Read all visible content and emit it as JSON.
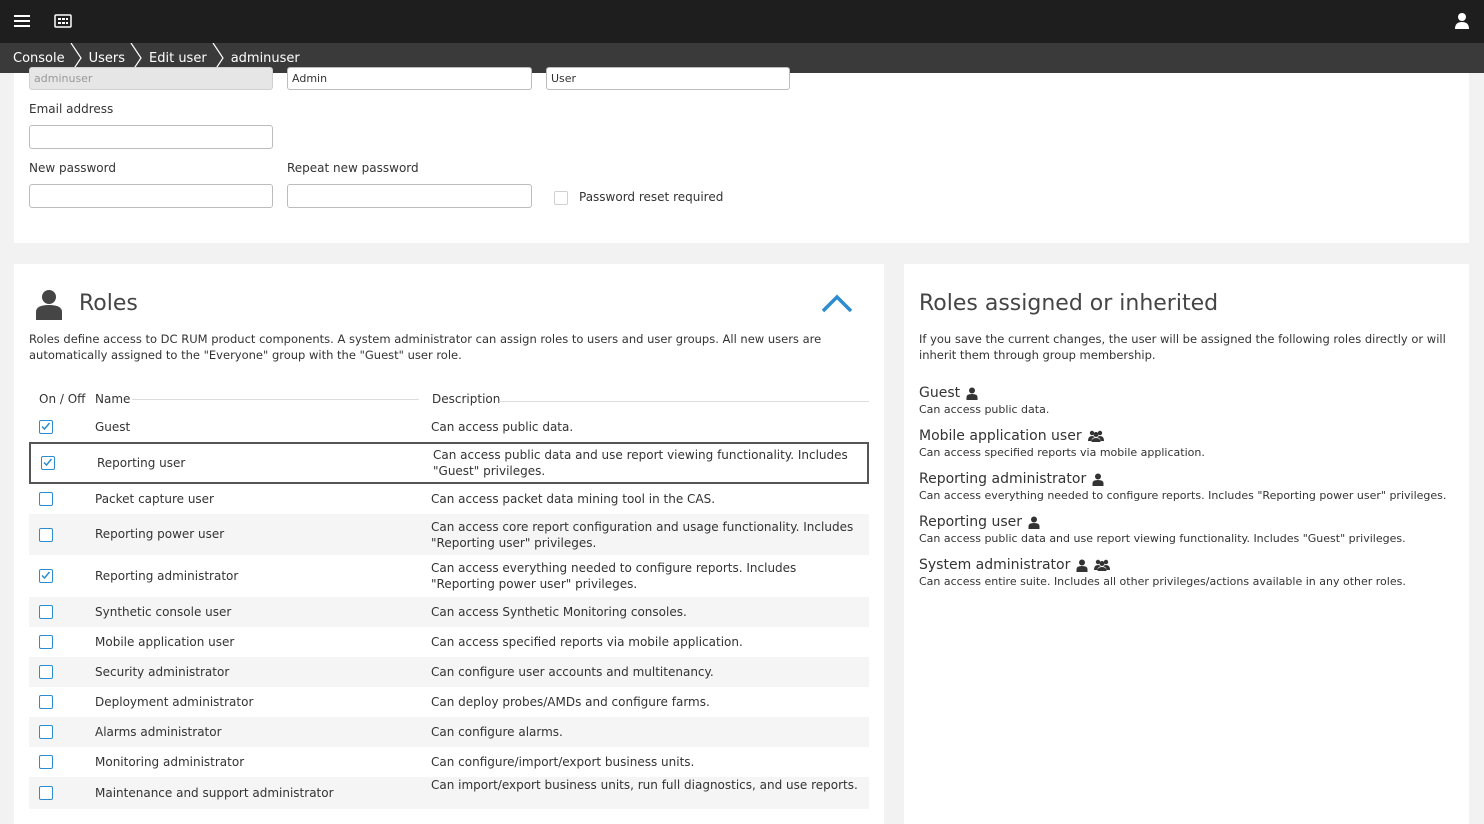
{
  "topbar": {
    "menu_icon": "hamburger-menu-icon",
    "dashboard_icon": "dashboard-icon",
    "user_icon": "user-icon"
  },
  "breadcrumb": [
    "Console",
    "Users",
    "Edit user",
    "adminuser"
  ],
  "user_form": {
    "username_value": "adminuser",
    "first_name_value": "Admin",
    "last_name_value": "User",
    "email_label": "Email address",
    "email_value": "",
    "new_password_label": "New password",
    "repeat_password_label": "Repeat new password",
    "password_reset_label": "Password reset required"
  },
  "roles": {
    "title": "Roles",
    "description": "Roles define access to DC RUM product components. A system administrator can assign roles to users and user groups. All new users are automatically assigned to the \"Everyone\" group with the \"Guest\" user role.",
    "columns": {
      "onoff": "On / Off",
      "name": "Name",
      "description": "Description"
    },
    "rows": [
      {
        "name": "Guest",
        "description": "Can access public data.",
        "checked": true
      },
      {
        "name": "Reporting user",
        "description": "Can access public data and use report viewing functionality. Includes \"Guest\" privileges.",
        "checked": true
      },
      {
        "name": "Packet capture user",
        "description": "Can access packet data mining tool in the CAS.",
        "checked": false
      },
      {
        "name": "Reporting power user",
        "description": "Can access core report configuration and usage functionality. Includes \"Reporting user\" privileges.",
        "checked": false
      },
      {
        "name": "Reporting administrator",
        "description": "Can access everything needed to configure reports. Includes \"Reporting power user\" privileges.",
        "checked": true
      },
      {
        "name": "Synthetic console user",
        "description": "Can access Synthetic Monitoring consoles.",
        "checked": false
      },
      {
        "name": "Mobile application user",
        "description": "Can access specified reports via mobile application.",
        "checked": false
      },
      {
        "name": "Security administrator",
        "description": "Can configure user accounts and multitenancy.",
        "checked": false
      },
      {
        "name": "Deployment administrator",
        "description": "Can deploy probes/AMDs and configure farms.",
        "checked": false
      },
      {
        "name": "Alarms administrator",
        "description": "Can configure alarms.",
        "checked": false
      },
      {
        "name": "Monitoring administrator",
        "description": "Can configure/import/export business units.",
        "checked": false
      },
      {
        "name": "Maintenance and support administrator",
        "description": "Can import/export business units, run full diagnostics, and use reports.",
        "checked": false
      }
    ]
  },
  "assigned": {
    "title": "Roles assigned or inherited",
    "description": "If you save the current changes, the user will be assigned the following roles directly or will inherit them through group membership.",
    "items": [
      {
        "name": "Guest",
        "description": "Can access public data.",
        "icons": [
          "user-icon"
        ]
      },
      {
        "name": "Mobile application user",
        "description": "Can access specified reports via mobile application.",
        "icons": [
          "group-icon"
        ]
      },
      {
        "name": "Reporting administrator",
        "description": "Can access everything needed to configure reports. Includes \"Reporting power user\" privileges.",
        "icons": [
          "user-icon"
        ]
      },
      {
        "name": "Reporting user",
        "description": "Can access public data and use report viewing functionality. Includes \"Guest\" privileges.",
        "icons": [
          "user-icon"
        ]
      },
      {
        "name": "System administrator",
        "description": "Can access entire suite. Includes all other privileges/actions available in any other roles.",
        "icons": [
          "user-icon",
          "group-icon"
        ]
      }
    ]
  },
  "colors": {
    "accent": "#2d8ccf",
    "topbar": "#1e1e1e",
    "breadcrumb": "#3a3a3a"
  }
}
